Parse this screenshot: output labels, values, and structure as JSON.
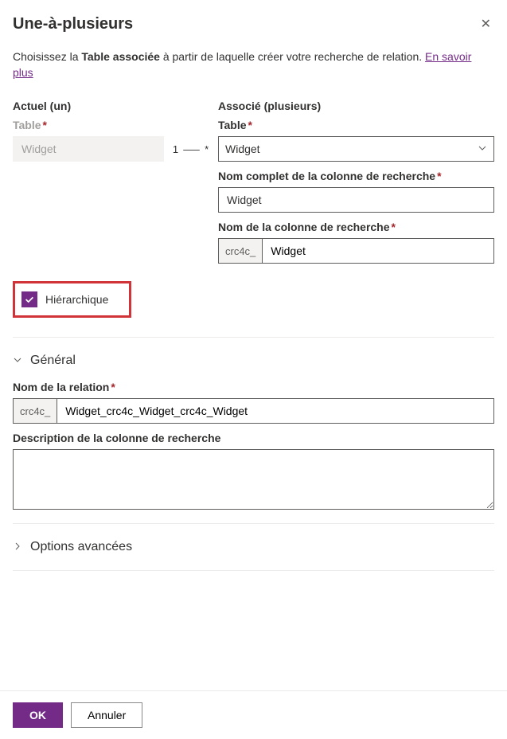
{
  "header": {
    "title": "Une-à-plusieurs"
  },
  "intro": {
    "pre": "Choisissez la ",
    "bold": "Table associée",
    "post": " à partir de laquelle créer votre recherche de relation. ",
    "link": "En savoir plus"
  },
  "current": {
    "heading": "Actuel (un)",
    "table_label": "Table",
    "table_value": "Widget"
  },
  "cardinality": "1 ⸺ *",
  "related": {
    "heading": "Associé (plusieurs)",
    "table_label": "Table",
    "table_value": "Widget",
    "display_name_label": "Nom complet de la colonne de recherche",
    "display_name_value": "Widget",
    "lookup_name_label": "Nom de la colonne de recherche",
    "lookup_prefix": "crc4c_",
    "lookup_name_value": "Widget"
  },
  "hierarchical": {
    "label": "Hiérarchique",
    "checked": true
  },
  "general": {
    "header": "Général",
    "relation_name_label": "Nom de la relation",
    "relation_prefix": "crc4c_",
    "relation_name_value": "Widget_crc4c_Widget_crc4c_Widget",
    "description_label": "Description de la colonne de recherche",
    "description_value": ""
  },
  "advanced": {
    "header": "Options avancées"
  },
  "footer": {
    "ok": "OK",
    "cancel": "Annuler"
  }
}
